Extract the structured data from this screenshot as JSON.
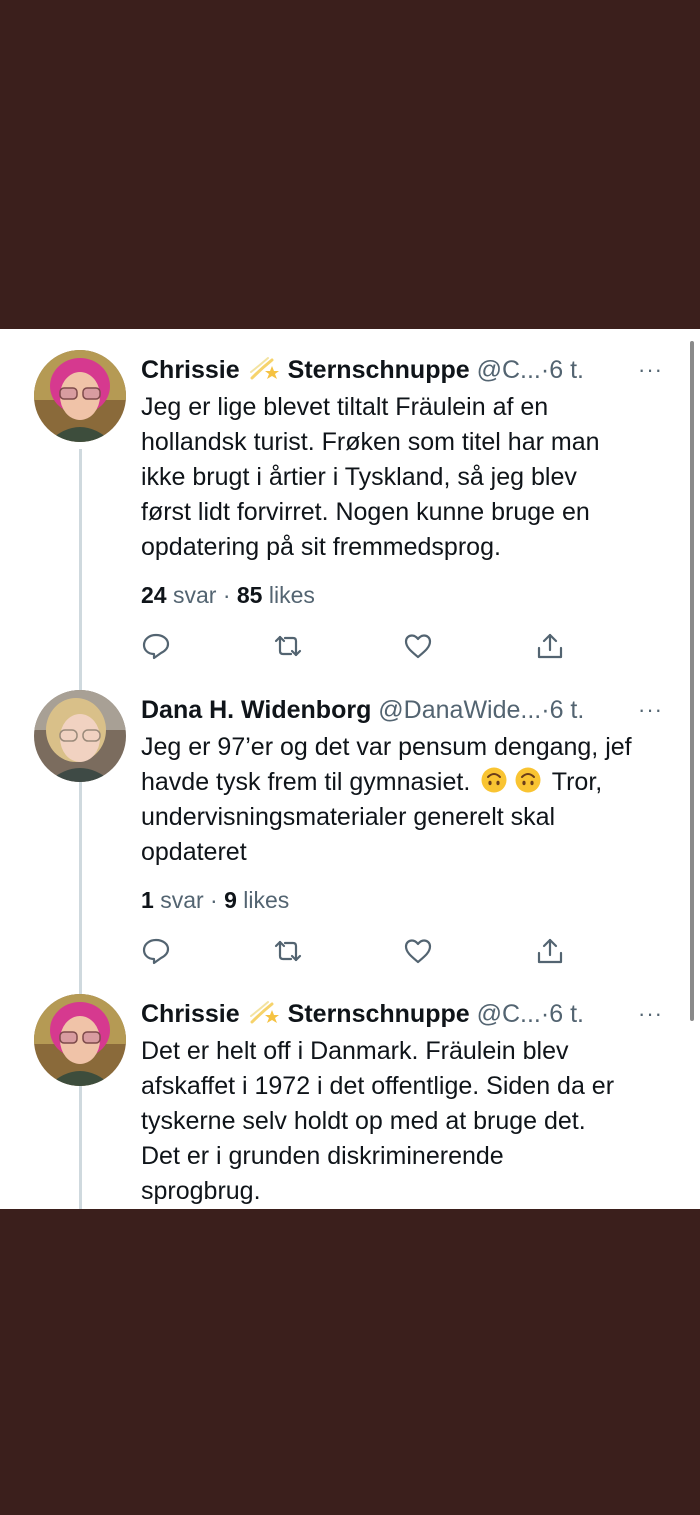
{
  "tweets": [
    {
      "name": "Chrissie",
      "name_suffix": "Sternschnuppe",
      "name_emoji": "shooting-star-emoji",
      "handle": "@C...",
      "separator": "·",
      "time": "6 t.",
      "more": "···",
      "text_lines": [
        "Jeg er lige blevet tiltalt Fräulein af en",
        "hollandsk turist. Frøken som titel har man",
        "ikke brugt i årtier i Tyskland, så jeg blev",
        "først lidt forvirret. Nogen kunne bruge en",
        "opdatering på sit fremmedsprog."
      ],
      "replies_count": "24",
      "replies_label": "svar",
      "stats_separator": "·",
      "likes_count": "85",
      "likes_label": "likes"
    },
    {
      "name": "Dana H. Widenborg",
      "handle": "@DanaWide...",
      "separator": "·",
      "time": "6 t.",
      "more": "···",
      "text_lines": [
        "Jeg er 97’er og det var pensum dengang, jef",
        "havde tysk frem til gymnasiet.",
        "undervisningsmaterialer generelt skal",
        "opdateret"
      ],
      "line2_tail": "Tror,",
      "inline_emojis": [
        "upside-down-face-emoji",
        "upside-down-face-emoji"
      ],
      "replies_count": "1",
      "replies_label": "svar",
      "stats_separator": "·",
      "likes_count": "9",
      "likes_label": "likes"
    },
    {
      "name": "Chrissie",
      "name_suffix": "Sternschnuppe",
      "name_emoji": "shooting-star-emoji",
      "handle": "@C...",
      "separator": "·",
      "time": "6 t.",
      "more": "···",
      "text_lines": [
        "Det er helt off i Danmark. Fräulein blev",
        "afskaffet i 1972 i det offentlige. Siden da er",
        "tyskerne selv holdt op med at bruge det.",
        "Det er i grunden diskriminerende",
        "sprogbrug."
      ]
    }
  ],
  "icons": [
    "reply-icon",
    "retweet-icon",
    "like-icon",
    "share-icon"
  ],
  "colors": {
    "background": "#3b1f1c",
    "card": "#ffffff",
    "text": "#0f1419",
    "secondary": "#536471",
    "thread_line": "#cfd9de"
  }
}
